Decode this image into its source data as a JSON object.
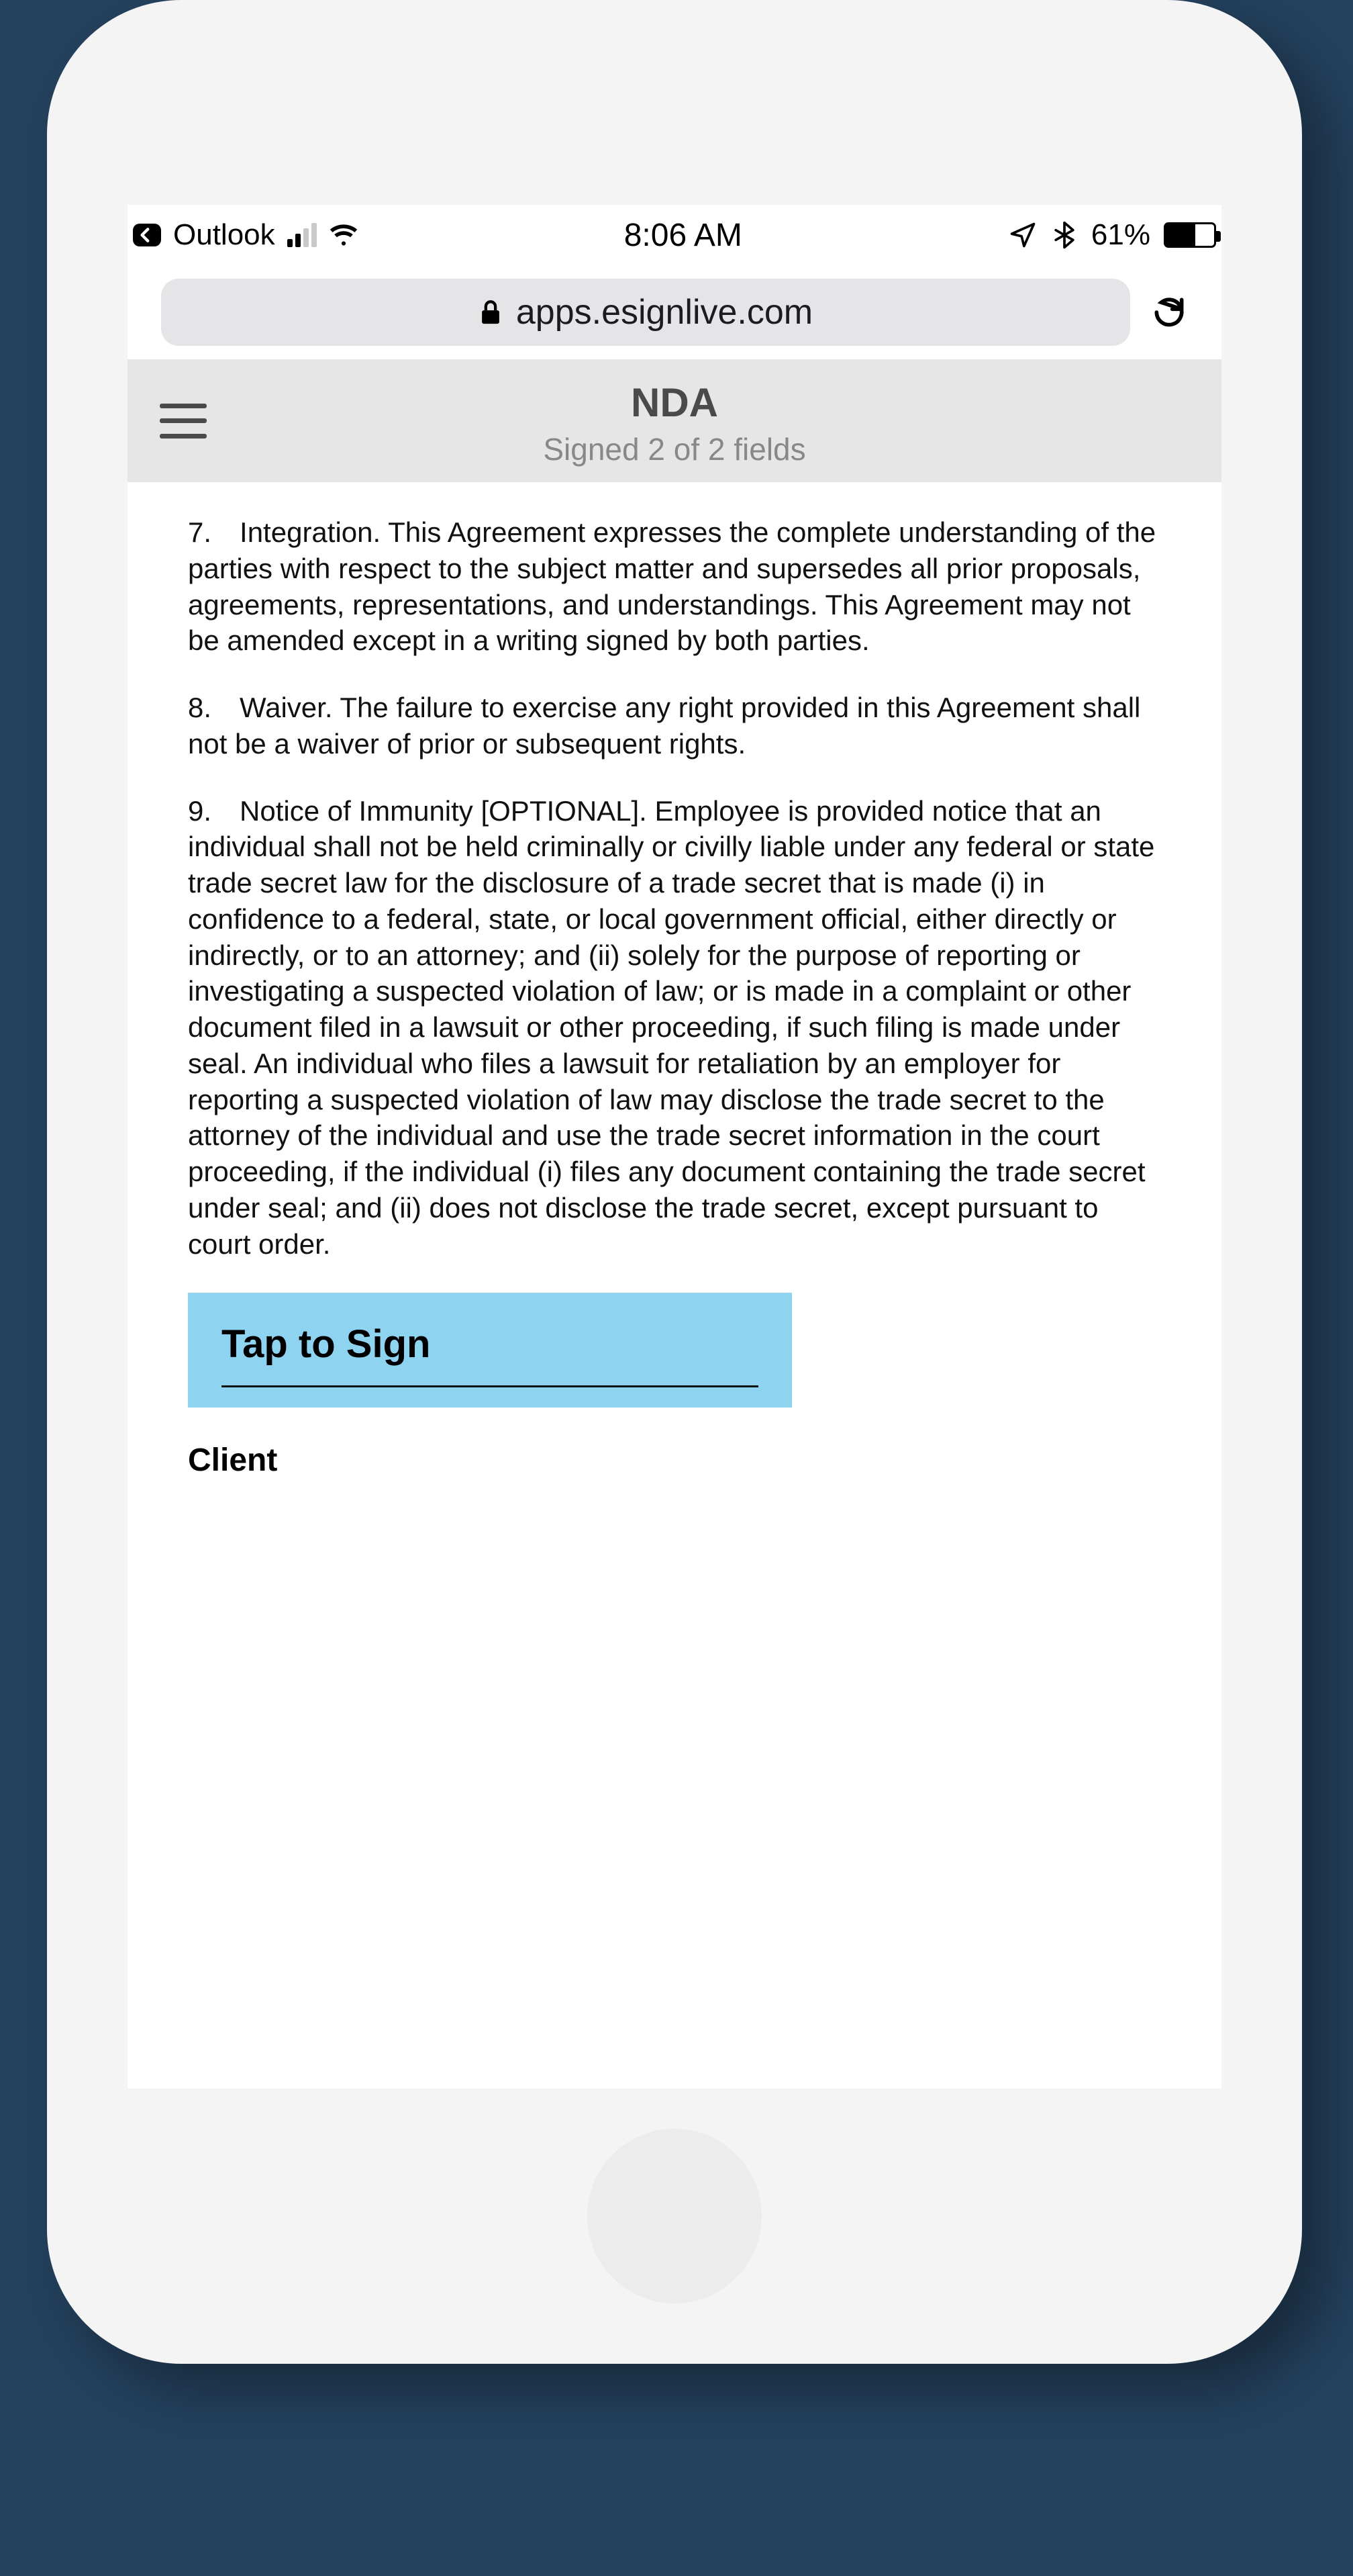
{
  "statusbar": {
    "back_app": "Outlook",
    "time": "8:06 AM",
    "battery_pct": "61%"
  },
  "browser": {
    "host": "apps.esignlive.com"
  },
  "header": {
    "title": "NDA",
    "subtitle": "Signed 2 of 2 fields"
  },
  "document": {
    "p7": "7. Integration. This Agreement expresses the complete understanding of the parties with respect to the subject matter and supersedes all prior proposals, agreements, representations, and understandings. This Agreement may not be amended except in a writing signed by both parties.",
    "p8": "8. Waiver. The failure to exercise any right provided in this Agreement shall not be a waiver of prior or subsequent rights.",
    "p9": "9. Notice of Immunity [OPTIONAL]. Employee is provided notice that an individual shall not be held criminally or civilly liable under any federal or state trade secret law for the disclosure of a trade secret that is made (i) in confidence to a federal, state, or local government official, either directly or indirectly, or to an attorney; and (ii) solely for the purpose of reporting or investigating a suspected violation of law; or is made in a complaint or other document filed in a lawsuit or other proceeding, if such filing is made under seal. An individual who files a lawsuit for retaliation by an employer for reporting a suspected violation of law may disclose the trade secret to the attorney of the individual and use the trade secret information in the court proceeding, if the individual (i) files any document containing the trade secret under seal; and (ii) does not disclose the trade secret, except pursuant to court order."
  },
  "sign": {
    "cta": "Tap to Sign",
    "role": "Client"
  }
}
